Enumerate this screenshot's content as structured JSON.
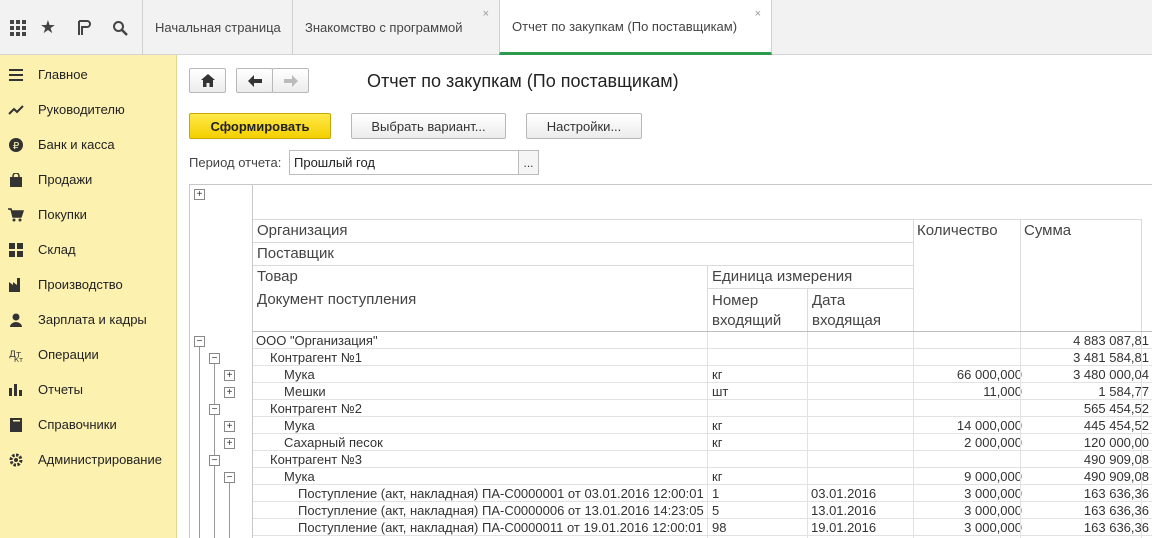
{
  "tabs": [
    {
      "label": "Начальная страница"
    },
    {
      "label": "Знакомство с программой",
      "close": "×"
    },
    {
      "label": "Отчет по закупкам (По поставщикам)",
      "close": "×"
    }
  ],
  "sidebar": {
    "items": [
      {
        "label": "Главное",
        "icon": "menu-icon"
      },
      {
        "label": "Руководителю",
        "icon": "trend-icon"
      },
      {
        "label": "Банк и касса",
        "icon": "ruble-icon"
      },
      {
        "label": "Продажи",
        "icon": "bag-icon"
      },
      {
        "label": "Покупки",
        "icon": "cart-icon"
      },
      {
        "label": "Склад",
        "icon": "grid-icon"
      },
      {
        "label": "Производство",
        "icon": "factory-icon"
      },
      {
        "label": "Зарплата и кадры",
        "icon": "person-icon"
      },
      {
        "label": "Операции",
        "icon": "operations-icon"
      },
      {
        "label": "Отчеты",
        "icon": "bar-chart-icon"
      },
      {
        "label": "Справочники",
        "icon": "book-icon"
      },
      {
        "label": "Администрирование",
        "icon": "gear-icon"
      }
    ]
  },
  "page": {
    "title": "Отчет по закупкам (По поставщикам)",
    "generate_label": "Сформировать",
    "variant_label": "Выбрать вариант...",
    "settings_label": "Настройки...",
    "period_label": "Период отчета:",
    "period_value": "Прошлый год",
    "period_dots": "..."
  },
  "report": {
    "headers": {
      "org": "Организация",
      "supplier": "Поставщик",
      "product": "Товар",
      "unit": "Единица измерения",
      "doc": "Документ поступления",
      "num_in": "Номер входящий",
      "date_in": "Дата входящая",
      "qty": "Количество",
      "sum": "Сумма"
    },
    "rows": [
      {
        "level": 0,
        "name": "ООО \"Организация\"",
        "unit": "",
        "date": "",
        "qty": "",
        "sum": "4 883 087,81"
      },
      {
        "level": 1,
        "name": "Контрагент №1",
        "unit": "",
        "date": "",
        "qty": "",
        "sum": "3 481 584,81"
      },
      {
        "level": 2,
        "name": "Мука",
        "unit": "кг",
        "date": "",
        "qty": "66 000,000",
        "sum": "3 480 000,04"
      },
      {
        "level": 2,
        "name": "Мешки",
        "unit": "шт",
        "date": "",
        "qty": "11,000",
        "sum": "1 584,77"
      },
      {
        "level": 1,
        "name": "Контрагент №2",
        "unit": "",
        "date": "",
        "qty": "",
        "sum": "565 454,52"
      },
      {
        "level": 2,
        "name": "Мука",
        "unit": "кг",
        "date": "",
        "qty": "14 000,000",
        "sum": "445 454,52"
      },
      {
        "level": 2,
        "name": "Сахарный песок",
        "unit": "кг",
        "date": "",
        "qty": "2 000,000",
        "sum": "120 000,00"
      },
      {
        "level": 1,
        "name": "Контрагент №3",
        "unit": "",
        "date": "",
        "qty": "",
        "sum": "490 909,08"
      },
      {
        "level": 2,
        "name": "Мука",
        "unit": "кг",
        "date": "",
        "qty": "9 000,000",
        "sum": "490 909,08"
      },
      {
        "level": 3,
        "name": "Поступление (акт, накладная) ПА-С0000001 от 03.01.2016 12:00:01",
        "unit": "1",
        "date": "03.01.2016",
        "qty": "3 000,000",
        "sum": "163 636,36"
      },
      {
        "level": 3,
        "name": "Поступление (акт, накладная) ПА-С0000006 от 13.01.2016 14:23:05",
        "unit": "5",
        "date": "13.01.2016",
        "qty": "3 000,000",
        "sum": "163 636,36"
      },
      {
        "level": 3,
        "name": "Поступление (акт, накладная) ПА-С0000011 от 19.01.2016 12:00:01",
        "unit": "98",
        "date": "19.01.2016",
        "qty": "3 000,000",
        "sum": "163 636,36"
      }
    ]
  },
  "colors": {
    "sidebar_bg": "#fdf1b0",
    "accent_green": "#2e9a50",
    "primary_button": "#f4cf00"
  }
}
